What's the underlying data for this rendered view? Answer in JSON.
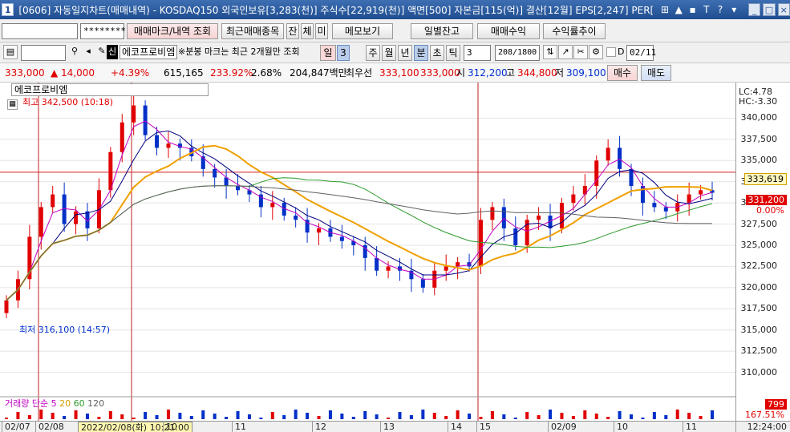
{
  "window": {
    "number": "1",
    "title": "[0606] 자동일지차트(매매내역) - KOSDAQ150 외국인보유[3,283(천)] 주식수[22,919(천)] 액면[500] 자본금[115(억)] 결산[12월] EPS[2,247] PER[",
    "buttons": [
      "⊞",
      "▲",
      "▪",
      "T",
      "?",
      "▾"
    ],
    "window_controls": [
      "_",
      "□",
      "×"
    ]
  },
  "toolbar1": {
    "code_input": "",
    "password": "********",
    "trade_mark_button": "매매마크/내역 조회",
    "recent_items_button": "최근매매종목",
    "tab_jan": "잔",
    "tab_che": "체",
    "tab_mi": "미",
    "memo_button": "메모보기",
    "daily_balance_button": "일별잔고",
    "trade_profit_button": "매매수익",
    "return_trend_button": "수익률추이"
  },
  "toolbar2": {
    "stock_badge": "신",
    "stock_name": "에코프로비엠",
    "notice": "※분봉 마크는 최근 2개월만 조회",
    "period_day": "일",
    "period_value": "3",
    "period_week": "주",
    "period_month": "월",
    "period_year": "년",
    "period_minute": "분",
    "period_second": "초",
    "period_tick": "틱",
    "interval_value": "3",
    "count": "208/1800",
    "checkbox_label": "D",
    "date": "02/11"
  },
  "quote": {
    "price": "333,000",
    "change": "▲ 14,000",
    "change_pct": "+4.39%",
    "volume": "615,165",
    "vol_ratio": "233.92%",
    "turnover": "2.68%",
    "amount": "204,847백만",
    "best_label": "최우선",
    "ask": "333,100",
    "bid": "333,000",
    "open_label": "시",
    "open": "312,200",
    "high_label": "고",
    "high": "344,800",
    "low": "309,100",
    "buy_button": "매수",
    "sell_button": "매도"
  },
  "chart": {
    "series_name": "에코프로비엠",
    "high_note": "최고 342,500 (10:18)",
    "low_note": "최저 316,100 (14:57)",
    "lc_label": "LC:4.78",
    "hc_label": "HC:-3.30",
    "current_price_tag": "333,619",
    "prev_tag": "331,200",
    "pct_tag": "0.00%",
    "volume_legend": "거래량 단순 5",
    "volume_legend_b": "20",
    "volume_legend_c": "60",
    "volume_legend_d": "120",
    "volume_side_value": "799",
    "volume_side_pct": "167.51%",
    "cursor_date": "2022/02/08(화) 10:21:00",
    "time_label": "12:24:00",
    "colors": {
      "up": "#e00000",
      "down": "#0030c8",
      "ma5": "#c000c0",
      "ma20": "#000080",
      "ma60_orange": "#f0a000",
      "ma120_green": "#2a9a2a",
      "ma_gray": "#606060"
    }
  },
  "chart_data": {
    "type": "line",
    "ylim": [
      307500,
      342500
    ],
    "yticks": [
      "340,000",
      "337,500",
      "335,000",
      "332,500",
      "330,000",
      "327,500",
      "325,000",
      "322,500",
      "320,000",
      "317,500",
      "315,000",
      "312,500",
      "310,000"
    ],
    "xticks": [
      "02/07",
      "02/08",
      "10",
      "11",
      "12",
      "13",
      "14",
      "15",
      "02/09",
      "10",
      "11",
      "12"
    ],
    "series": [
      {
        "name": "close",
        "values": [
          318500,
          321000,
          326000,
          329500,
          331000,
          327500,
          329000,
          327000,
          331500,
          336000,
          339500,
          341500,
          338000,
          336500,
          337000,
          336500,
          335500,
          334000,
          333000,
          332000,
          331500,
          331000,
          329500,
          330000,
          328500,
          328000,
          326500,
          327000,
          326000,
          325500,
          325000,
          323500,
          322000,
          322500,
          322000,
          321000,
          320000,
          322000,
          322500,
          323000,
          322500,
          328000,
          329500,
          327000,
          325000,
          328000,
          328500,
          327000,
          330000,
          331000,
          332000,
          335000,
          336500,
          334000,
          332000,
          330000,
          329500,
          329000,
          330000,
          331000,
          331500,
          331200
        ]
      }
    ]
  }
}
